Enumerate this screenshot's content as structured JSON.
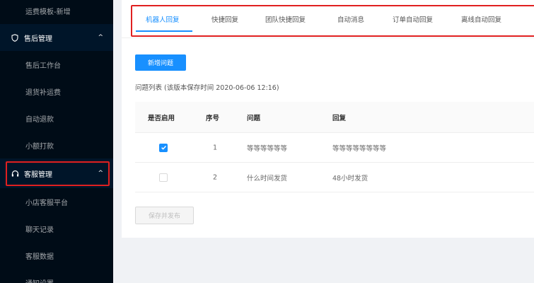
{
  "sidebar": {
    "items": [
      {
        "label": "运费模板-新增",
        "type": "sub"
      },
      {
        "label": "售后管理",
        "type": "group",
        "icon": "shield-icon"
      },
      {
        "label": "售后工作台",
        "type": "sub"
      },
      {
        "label": "退货补运费",
        "type": "sub"
      },
      {
        "label": "自动退款",
        "type": "sub"
      },
      {
        "label": "小额打款",
        "type": "sub"
      },
      {
        "label": "客服管理",
        "type": "group",
        "icon": "headset-icon"
      },
      {
        "label": "小店客服平台",
        "type": "sub"
      },
      {
        "label": "聊天记录",
        "type": "sub"
      },
      {
        "label": "客服数据",
        "type": "sub"
      },
      {
        "label": "通知设置",
        "type": "sub"
      }
    ]
  },
  "tabs": [
    {
      "label": "机器人回复",
      "active": true
    },
    {
      "label": "快捷回复"
    },
    {
      "label": "团队快捷回复"
    },
    {
      "label": "自动消息"
    },
    {
      "label": "订单自动回复"
    },
    {
      "label": "离线自动回复"
    }
  ],
  "main": {
    "new_question_label": "新增问题",
    "list_title": "问题列表 (该版本保存时间 2020-06-06 12:16)",
    "table": {
      "headers": [
        "是否启用",
        "序号",
        "问题",
        "回复"
      ],
      "rows": [
        {
          "enabled": true,
          "index": "1",
          "question": "等等等等等等",
          "reply": "等等等等等等等等"
        },
        {
          "enabled": false,
          "index": "2",
          "question": "什么时间发货",
          "reply": "48小时发货"
        }
      ]
    },
    "save_publish_label": "保存并发布"
  },
  "colors": {
    "sidebar_bg": "#001529",
    "sidebar_sub_bg": "#000c17",
    "accent": "#1890ff",
    "highlight": "#e02020"
  }
}
